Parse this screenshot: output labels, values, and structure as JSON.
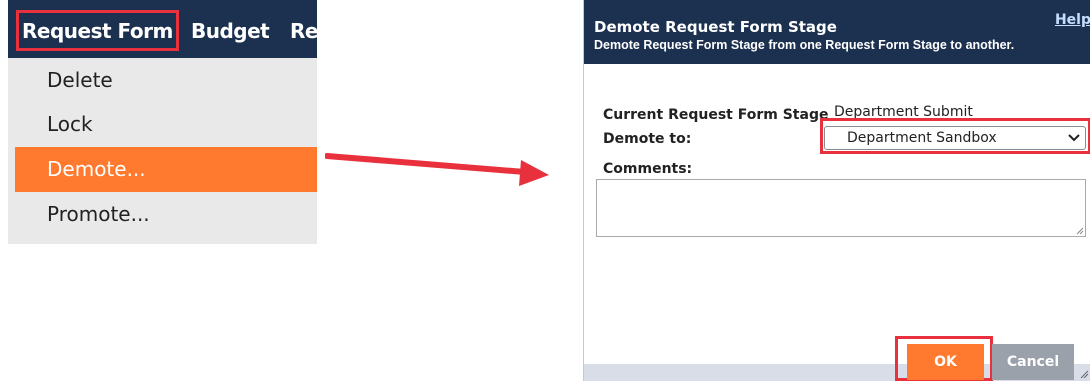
{
  "menu": {
    "items": [
      "Request Form",
      "Budget",
      "Re"
    ],
    "dropdown": [
      {
        "label": "Delete"
      },
      {
        "label": "Lock"
      },
      {
        "label": "Demote...",
        "active": true
      },
      {
        "label": "Promote..."
      }
    ]
  },
  "dialog": {
    "title": "Demote Request Form Stage",
    "subtitle": "Demote Request Form Stage from one Request Form Stage to another.",
    "help_link": "Help",
    "current_stage_label": "Current Request Form Stage",
    "current_stage_value": "Department Submit",
    "demote_to_label": "Demote to:",
    "demote_to_value": "Department Sandbox",
    "comments_label": "Comments:",
    "comments_value": "",
    "ok_label": "OK",
    "cancel_label": "Cancel"
  },
  "colors": {
    "header_bg": "#1c3150",
    "highlight": "#e8313c",
    "accent": "#ff7a2e",
    "arrow": "#e8313c"
  },
  "icons": {
    "select_chevron": "chevron-down-icon",
    "arrow": "arrow-right-icon"
  }
}
